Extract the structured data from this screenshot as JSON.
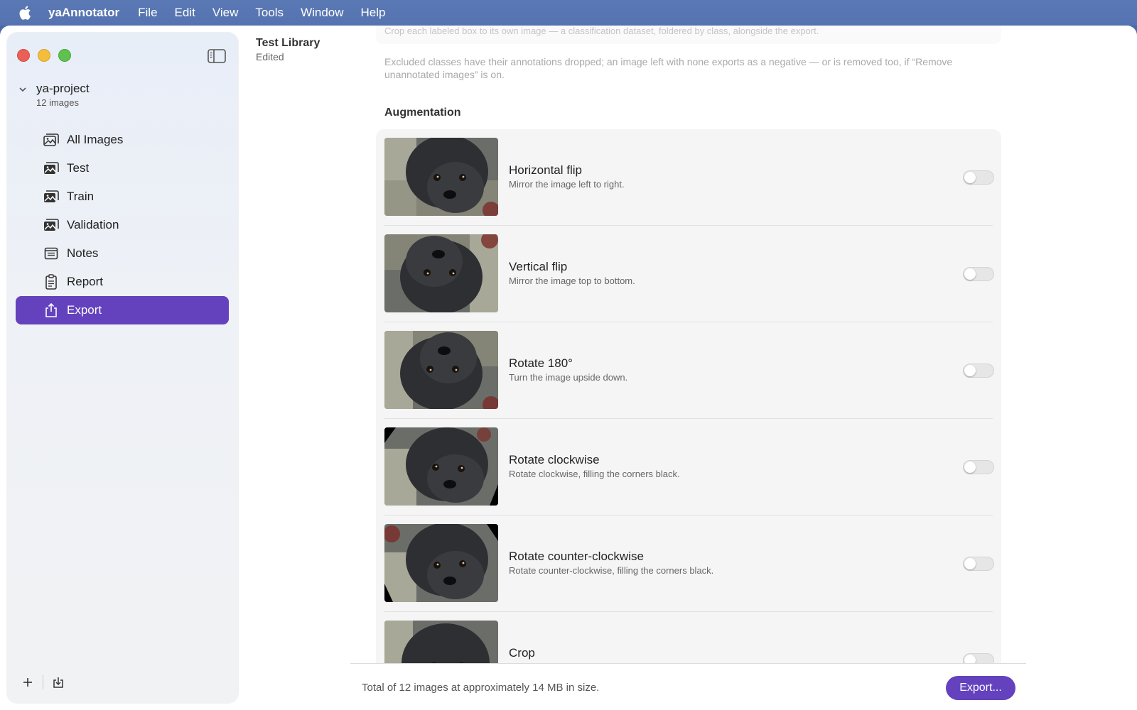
{
  "menubar": {
    "app_name": "yaAnnotator",
    "items": [
      "File",
      "Edit",
      "View",
      "Tools",
      "Window",
      "Help"
    ]
  },
  "sidebar": {
    "project": {
      "name": "ya-project",
      "count": "12 images"
    },
    "items": [
      {
        "label": "All Images",
        "icon": "images-icon"
      },
      {
        "label": "Test",
        "icon": "images-icon"
      },
      {
        "label": "Train",
        "icon": "images-icon"
      },
      {
        "label": "Validation",
        "icon": "images-icon"
      },
      {
        "label": "Notes",
        "icon": "notes-icon"
      },
      {
        "label": "Report",
        "icon": "clipboard-icon"
      },
      {
        "label": "Export",
        "icon": "export-icon",
        "selected": true
      }
    ]
  },
  "document": {
    "title": "Test Library",
    "status": "Edited"
  },
  "main": {
    "faded_top_text": "Crop each labeled box to its own image — a classification dataset, foldered by class, alongside the export.",
    "excluded_note": "Excluded classes have their annotations dropped; an image left with none exports as a negative — or is removed too, if “Remove unannotated images” is on.",
    "augmentation_title": "Augmentation",
    "augmentations": [
      {
        "title": "Horizontal flip",
        "desc": "Mirror the image left to right.",
        "enabled": false
      },
      {
        "title": "Vertical flip",
        "desc": "Mirror the image top to bottom.",
        "enabled": false
      },
      {
        "title": "Rotate 180°",
        "desc": "Turn the image upside down.",
        "enabled": false
      },
      {
        "title": "Rotate clockwise",
        "desc": "Rotate clockwise, filling the corners black.",
        "enabled": false
      },
      {
        "title": "Rotate counter-clockwise",
        "desc": "Rotate counter-clockwise, filling the corners black.",
        "enabled": false
      },
      {
        "title": "Crop",
        "desc": "",
        "enabled": false
      }
    ]
  },
  "footer": {
    "total": "Total of 12 images at approximately 14 MB in size.",
    "export_label": "Export..."
  },
  "colors": {
    "accent": "#6442be",
    "menubar": "#5573b0"
  }
}
